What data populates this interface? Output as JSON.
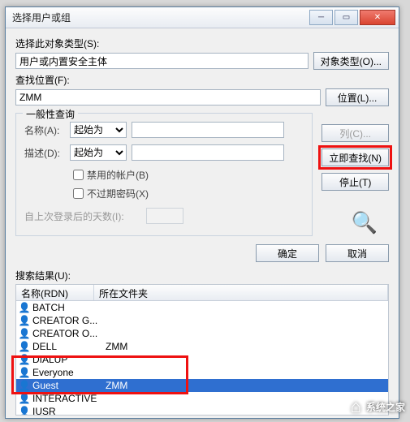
{
  "titlebar": {
    "title": "选择用户或组"
  },
  "section_object_type": {
    "label": "选择此对象类型(S):",
    "value": "用户或内置安全主体",
    "button": "对象类型(O)..."
  },
  "section_location": {
    "label": "查找位置(F):",
    "value": "ZMM",
    "button": "位置(L)..."
  },
  "group_title": "一般性查询",
  "query": {
    "name_label": "名称(A):",
    "name_combo": "起始为",
    "desc_label": "描述(D):",
    "desc_combo": "起始为",
    "chk_disabled": "禁用的帐户(B)",
    "chk_noexpire": "不过期密码(X)",
    "lastlogin_label": "自上次登录后的天数(I):"
  },
  "side": {
    "columns": "列(C)...",
    "find_now": "立即查找(N)",
    "stop": "停止(T)"
  },
  "actions": {
    "ok": "确定",
    "cancel": "取消"
  },
  "results": {
    "label": "搜索结果(U):",
    "col1": "名称(RDN)",
    "col2": "所在文件夹",
    "rows": [
      {
        "name": "BATCH",
        "folder": ""
      },
      {
        "name": "CREATOR G...",
        "folder": ""
      },
      {
        "name": "CREATOR O...",
        "folder": ""
      },
      {
        "name": "DELL",
        "folder": "ZMM"
      },
      {
        "name": "DIALUP",
        "folder": ""
      },
      {
        "name": "Everyone",
        "folder": ""
      },
      {
        "name": "Guest",
        "folder": "ZMM",
        "selected": true
      },
      {
        "name": "INTERACTIVE",
        "folder": ""
      },
      {
        "name": "IUSR",
        "folder": ""
      }
    ]
  },
  "watermark": "系统之家"
}
